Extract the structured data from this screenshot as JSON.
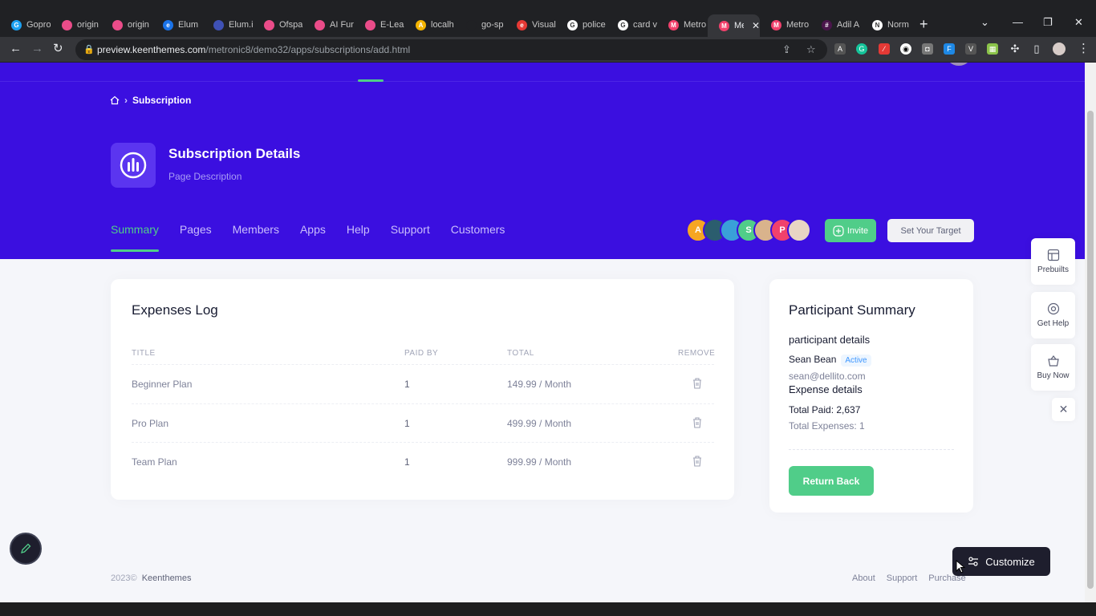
{
  "browser": {
    "tabs": [
      {
        "label": "Gopro",
        "color": "#1da1f2",
        "glyph": "G"
      },
      {
        "label": "origin",
        "color": "#ea4c89",
        "glyph": ""
      },
      {
        "label": "origin",
        "color": "#ea4c89",
        "glyph": ""
      },
      {
        "label": "Elum",
        "color": "#1a73e8",
        "glyph": "e"
      },
      {
        "label": "Elum.i",
        "color": "#3f51b5",
        "glyph": ""
      },
      {
        "label": "Ofspa",
        "color": "#ea4c89",
        "glyph": ""
      },
      {
        "label": "AI Fun",
        "color": "#ea4c89",
        "glyph": ""
      },
      {
        "label": "E-Lear",
        "color": "#ea4c89",
        "glyph": ""
      },
      {
        "label": "localh",
        "color": "#f4b400",
        "glyph": "A"
      },
      {
        "label": "go-sp",
        "color": "#202124",
        "glyph": ""
      },
      {
        "label": "Visual",
        "color": "#e53935",
        "glyph": "e"
      },
      {
        "label": "police",
        "color": "#ffffff",
        "glyph": "G"
      },
      {
        "label": "card v",
        "color": "#ffffff",
        "glyph": "G"
      },
      {
        "label": "Metro",
        "color": "#f1416c",
        "glyph": "M"
      },
      {
        "label": "Me",
        "color": "#f1416c",
        "glyph": "M"
      },
      {
        "label": "Metro",
        "color": "#f1416c",
        "glyph": "M"
      },
      {
        "label": "Adil A",
        "color": "#4a154b",
        "glyph": "#"
      },
      {
        "label": "Norm",
        "color": "#ffffff",
        "glyph": "N"
      }
    ],
    "url_host": "preview.keenthemes.com",
    "url_path": "/metronic8/demo32/apps/subscriptions/add.html"
  },
  "breadcrumb": {
    "current": "Subscription"
  },
  "header": {
    "title": "Subscription Details",
    "description": "Page Description",
    "tabs": [
      "Summary",
      "Pages",
      "Members",
      "Apps",
      "Help",
      "Support",
      "Customers"
    ],
    "active_tab": "Summary",
    "avatars": [
      {
        "letter": "A",
        "color": "#f6a623"
      },
      {
        "letter": "",
        "color": "#2b5d6e"
      },
      {
        "letter": "",
        "color": "#3aa0d8"
      },
      {
        "letter": "S",
        "color": "#50cd89"
      },
      {
        "letter": "",
        "color": "#d9b38c"
      },
      {
        "letter": "P",
        "color": "#f1416c"
      },
      {
        "letter": "",
        "color": "#e8d5c4"
      }
    ],
    "invite_label": "Invite",
    "target_label": "Set Your Target"
  },
  "expenses": {
    "title": "Expenses Log",
    "columns": [
      "TITLE",
      "PAID BY",
      "TOTAL",
      "REMOVE"
    ],
    "rows": [
      {
        "title": "Beginner Plan",
        "paid_by": "1",
        "total": "149.99 / Month"
      },
      {
        "title": "Pro Plan",
        "paid_by": "1",
        "total": "499.99 / Month"
      },
      {
        "title": "Team Plan",
        "paid_by": "1",
        "total": "999.99 / Month"
      }
    ]
  },
  "participant": {
    "title": "Participant Summary",
    "section1": "participant details",
    "name": "Sean Bean",
    "status": "Active",
    "email": "sean@dellito.com",
    "section2": "Expense details",
    "total_paid": "Total Paid: 2,637",
    "total_expenses": "Total Expenses: 1",
    "return_label": "Return Back"
  },
  "side_panel": {
    "prebuilts": "Prebuilts",
    "get_help": "Get Help",
    "buy_now": "Buy Now"
  },
  "customize_label": "Customize",
  "footer": {
    "year": "2023©",
    "brand": "Keenthemes",
    "links": [
      "About",
      "Support",
      "Purchase"
    ]
  },
  "colors": {
    "hero": "#3b0fe0",
    "accent": "#50cd89",
    "active_badge": "#3e97ff"
  }
}
